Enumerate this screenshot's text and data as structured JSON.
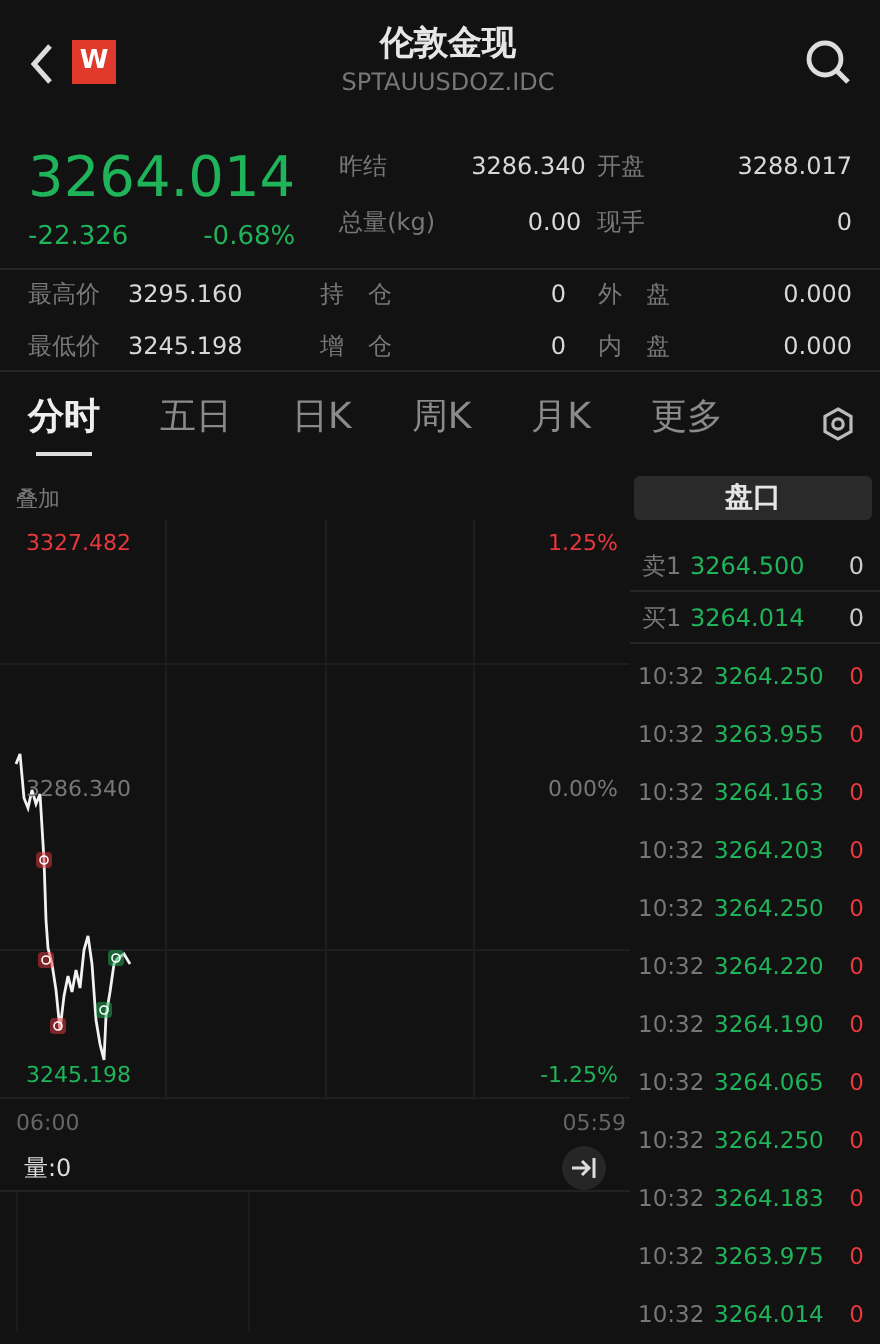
{
  "header": {
    "logo": "W",
    "title": "伦敦金现",
    "code": "SPTAUUSDOZ.IDC"
  },
  "quote": {
    "price": "3264.014",
    "change": "-22.326",
    "change_pct": "-0.68%"
  },
  "stats_top": [
    {
      "label": "昨结",
      "value": "3286.340"
    },
    {
      "label": "开盘",
      "value": "3288.017"
    },
    {
      "label": "总量(kg)",
      "value": "0.00"
    },
    {
      "label": "现手",
      "value": "0"
    }
  ],
  "stats_bottom": [
    {
      "label": "最高价",
      "value": "3295.160"
    },
    {
      "label": "持　仓",
      "value": "0"
    },
    {
      "label": "外　盘",
      "value": "0.000"
    },
    {
      "label": "最低价",
      "value": "3245.198"
    },
    {
      "label": "增　仓",
      "value": "0"
    },
    {
      "label": "内　盘",
      "value": "0.000"
    }
  ],
  "tabs": [
    {
      "label": "分时",
      "selected": true
    },
    {
      "label": "五日",
      "selected": false
    },
    {
      "label": "日K",
      "selected": false
    },
    {
      "label": "周K",
      "selected": false
    },
    {
      "label": "月K",
      "selected": false
    },
    {
      "label": "更多",
      "selected": false
    }
  ],
  "overlay_label": "叠加",
  "panel_button": "盘口",
  "chart": {
    "price_high": "3327.482",
    "pct_high": "1.25%",
    "price_mid": "3286.340",
    "pct_mid": "0.00%",
    "price_low": "3245.198",
    "pct_low": "-1.25%",
    "time_start": "06:00",
    "time_end": "05:59",
    "volume_label": "量:0"
  },
  "order_book": [
    {
      "label": "卖1",
      "price": "3264.500",
      "volume": "0"
    },
    {
      "label": "买1",
      "price": "3264.014",
      "volume": "0"
    }
  ],
  "trades": [
    {
      "time": "10:32",
      "price": "3264.250",
      "volume": "0"
    },
    {
      "time": "10:32",
      "price": "3263.955",
      "volume": "0"
    },
    {
      "time": "10:32",
      "price": "3264.163",
      "volume": "0"
    },
    {
      "time": "10:32",
      "price": "3264.203",
      "volume": "0"
    },
    {
      "time": "10:32",
      "price": "3264.250",
      "volume": "0"
    },
    {
      "time": "10:32",
      "price": "3264.220",
      "volume": "0"
    },
    {
      "time": "10:32",
      "price": "3264.190",
      "volume": "0"
    },
    {
      "time": "10:32",
      "price": "3264.065",
      "volume": "0"
    },
    {
      "time": "10:32",
      "price": "3264.250",
      "volume": "0"
    },
    {
      "time": "10:32",
      "price": "3264.183",
      "volume": "0"
    },
    {
      "time": "10:32",
      "price": "3263.975",
      "volume": "0"
    },
    {
      "time": "10:32",
      "price": "3264.014",
      "volume": "0"
    }
  ]
}
